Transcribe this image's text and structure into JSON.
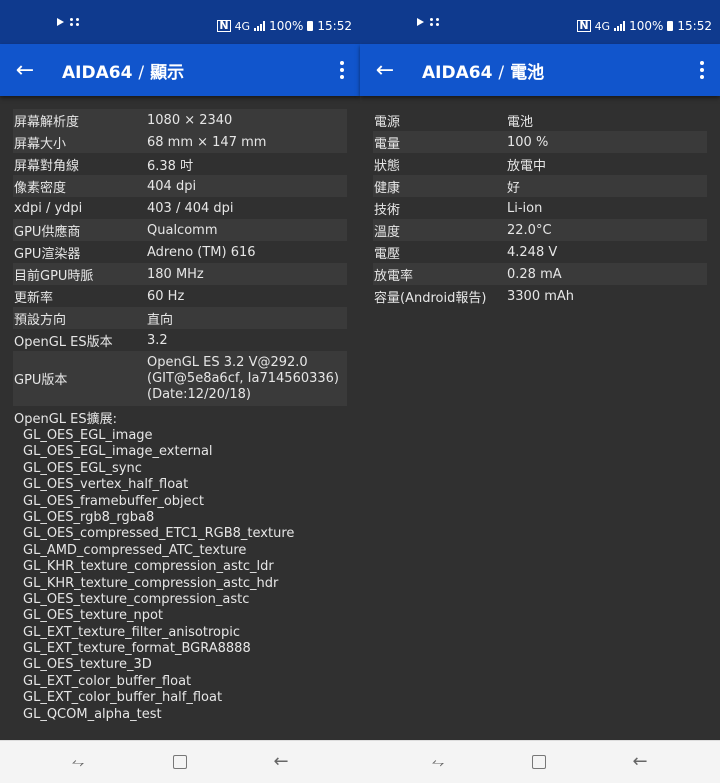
{
  "left": {
    "status": {
      "battery": "100%",
      "time": "15:52",
      "network": "4G"
    },
    "appbar": {
      "title_app": "AIDA64",
      "separator": "/",
      "title_section": "顯示"
    },
    "rows": [
      {
        "k": "屏幕解析度",
        "v": "1080 × 2340"
      },
      {
        "k": "屏幕大小",
        "v": "68 mm × 147 mm"
      },
      {
        "k": "屏幕對角線",
        "v": "6.38 吋"
      },
      {
        "k": "像素密度",
        "v": "404 dpi"
      },
      {
        "k": "xdpi / ydpi",
        "v": "403 / 404 dpi"
      },
      {
        "k": "GPU供應商",
        "v": "Qualcomm"
      },
      {
        "k": "GPU渲染器",
        "v": "Adreno (TM) 616"
      },
      {
        "k": "目前GPU時脈",
        "v": "180 MHz"
      },
      {
        "k": "更新率",
        "v": "60 Hz"
      },
      {
        "k": "預設方向",
        "v": "直向"
      },
      {
        "k": "OpenGL ES版本",
        "v": "3.2"
      }
    ],
    "gpu_version": {
      "k": "GPU版本",
      "v1": "OpenGL ES 3.2 V@292.0",
      "v2": "(GIT@5e8a6cf, Ia714560336)",
      "v3": "(Date:12/20/18)"
    },
    "extensions_title": "OpenGL ES擴展:",
    "extensions": [
      "GL_OES_EGL_image",
      "GL_OES_EGL_image_external",
      "GL_OES_EGL_sync",
      "GL_OES_vertex_half_float",
      "GL_OES_framebuffer_object",
      "GL_OES_rgb8_rgba8",
      "GL_OES_compressed_ETC1_RGB8_texture",
      "GL_AMD_compressed_ATC_texture",
      "GL_KHR_texture_compression_astc_ldr",
      "GL_KHR_texture_compression_astc_hdr",
      "GL_OES_texture_compression_astc",
      "GL_OES_texture_npot",
      "GL_EXT_texture_filter_anisotropic",
      "GL_EXT_texture_format_BGRA8888",
      "GL_OES_texture_3D",
      "GL_EXT_color_buffer_float",
      "GL_EXT_color_buffer_half_float",
      "GL_QCOM_alpha_test"
    ]
  },
  "right": {
    "status": {
      "battery": "100%",
      "time": "15:52",
      "network": "4G"
    },
    "appbar": {
      "title_app": "AIDA64",
      "separator": "/",
      "title_section": "電池"
    },
    "rows": [
      {
        "k": "電源",
        "v": "電池"
      },
      {
        "k": "電量",
        "v": "100 %"
      },
      {
        "k": "狀態",
        "v": "放電中"
      },
      {
        "k": "健康",
        "v": "好"
      },
      {
        "k": "技術",
        "v": "Li-ion"
      },
      {
        "k": "溫度",
        "v": "22.0°C"
      },
      {
        "k": "電壓",
        "v": "4.248 V"
      },
      {
        "k": "放電率",
        "v": "0.28 mA"
      },
      {
        "k": "容量(Android報告)",
        "v": "3300 mAh"
      }
    ]
  },
  "colors": {
    "statusbar": "#0f3a8e",
    "appbar": "#1155cc",
    "background": "#303030",
    "row_alt": "#3a3a3a"
  },
  "icons": [
    "back-arrow-icon",
    "overflow-menu-icon",
    "recents-icon",
    "home-icon",
    "nav-back-icon"
  ]
}
